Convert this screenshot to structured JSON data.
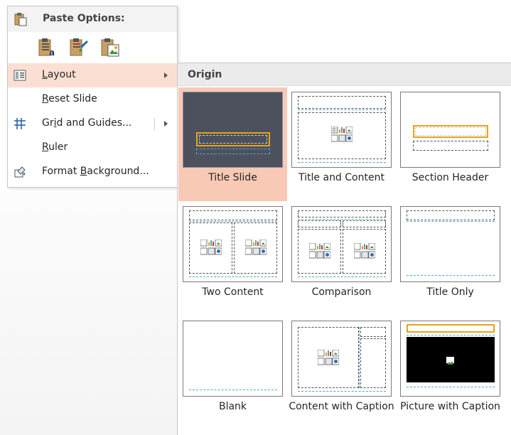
{
  "context_menu": {
    "paste_header": "Paste Options:",
    "paste_buttons": [
      {
        "name": "use-destination-theme-icon"
      },
      {
        "name": "keep-source-formatting-icon"
      },
      {
        "name": "picture-icon"
      }
    ],
    "items": [
      {
        "label": "Layout",
        "underline": "L",
        "icon": "layout-icon",
        "submenu": true,
        "active": true
      },
      {
        "label": "Reset Slide",
        "underline": "R",
        "icon": "",
        "submenu": false,
        "active": false
      },
      {
        "label": "Grid and Guides...",
        "underline": "i",
        "icon": "grid-icon",
        "submenu": true,
        "active": false
      },
      {
        "label": "Ruler",
        "underline": "R",
        "icon": "",
        "submenu": false,
        "active": false
      },
      {
        "label": "Format Background...",
        "underline": "B",
        "icon": "format-background-icon",
        "submenu": false,
        "active": false
      }
    ]
  },
  "gallery": {
    "section_title": "Origin",
    "layouts": [
      {
        "label": "Title Slide",
        "selected": true
      },
      {
        "label": "Title and Content",
        "selected": false
      },
      {
        "label": "Section Header",
        "selected": false
      },
      {
        "label": "Two Content",
        "selected": false
      },
      {
        "label": "Comparison",
        "selected": false
      },
      {
        "label": "Title Only",
        "selected": false
      },
      {
        "label": "Blank",
        "selected": false
      },
      {
        "label": "Content with Caption",
        "selected": false
      },
      {
        "label": "Picture with Caption",
        "selected": false
      }
    ]
  },
  "colors": {
    "highlight": "#fcdfd3",
    "selected_tile": "#f8c9b4",
    "placeholder_orange": "#e8a317",
    "placeholder_blue": "#4aa8c8"
  }
}
